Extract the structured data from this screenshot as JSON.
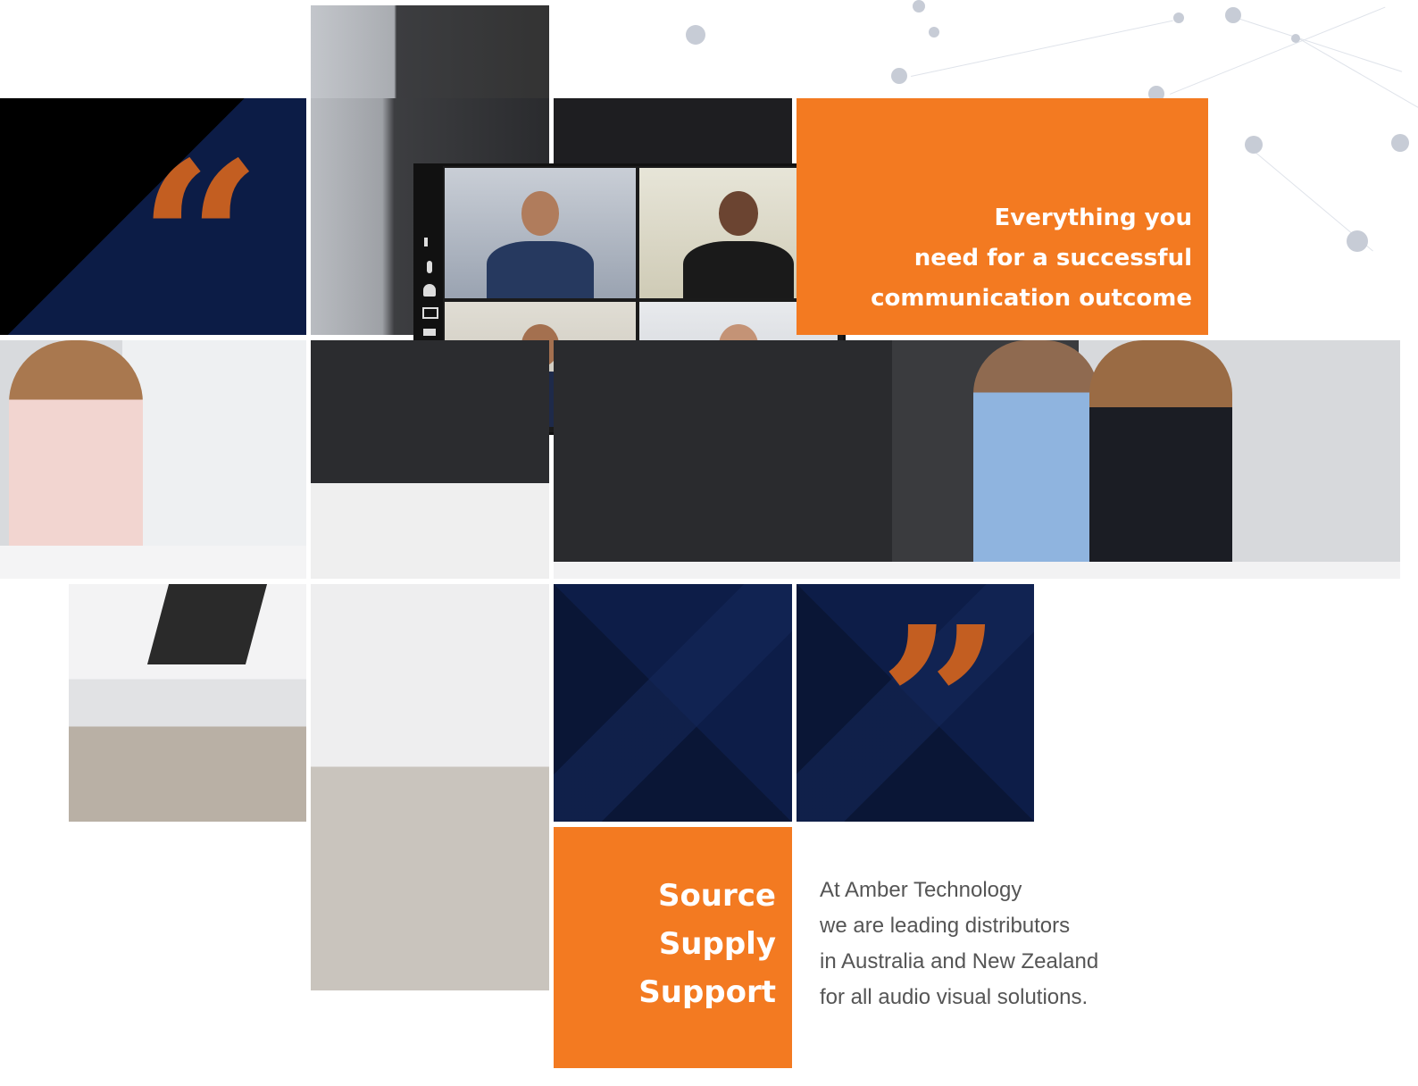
{
  "headline": {
    "line1": "Everything you",
    "line2": "need for a successful",
    "line3": "communication outcome"
  },
  "tagline": {
    "line1": "Source",
    "line2": "Supply",
    "line3": "Support"
  },
  "description": {
    "line1": "At Amber Technology",
    "line2": "we are leading distributors",
    "line3": "in Australia and New Zealand",
    "line4": "for all audio visual solutions."
  },
  "quote_marks": {
    "open": "“",
    "close": "”"
  },
  "colors": {
    "orange": "#f37a21",
    "quote_orange": "#c35e21",
    "navy": "#0a1636",
    "text_grey": "#555555"
  },
  "icons": [
    "speaker-icon",
    "microphone-icon",
    "person-icon",
    "monitor-icon",
    "camera-icon"
  ]
}
